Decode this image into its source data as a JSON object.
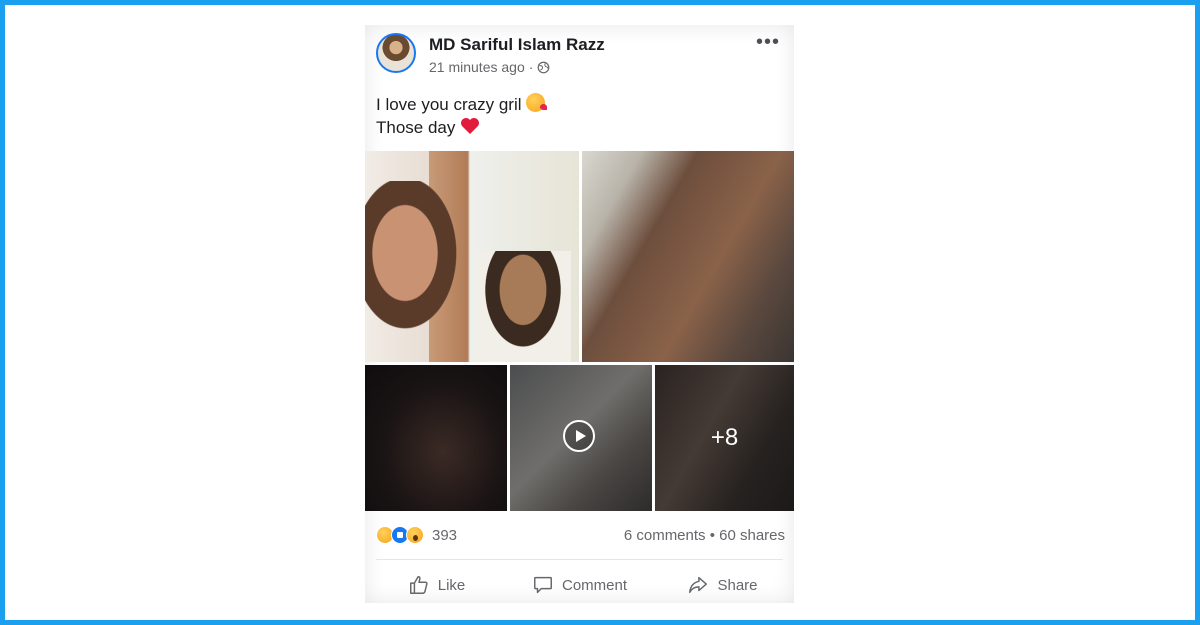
{
  "post": {
    "author": "MD Sariful Islam Razz",
    "time": "21 minutes ago",
    "privacy_separator": "·",
    "privacy_icon": "globe-icon",
    "more_icon": "•••",
    "caption_line1": "I love you crazy gril",
    "caption_line2": "Those day",
    "photos": {
      "play_icon": "play-icon",
      "more_count": "+8"
    },
    "reactions": {
      "icons": [
        "haha-icon",
        "like-icon",
        "wow-icon"
      ],
      "count": "393"
    },
    "engagement": "6 comments • 60 shares",
    "actions": {
      "like": "Like",
      "comment": "Comment",
      "share": "Share"
    }
  },
  "colors": {
    "frame": "#1aa0ef",
    "brand": "#1877f2",
    "secondary_text": "#65676b"
  }
}
